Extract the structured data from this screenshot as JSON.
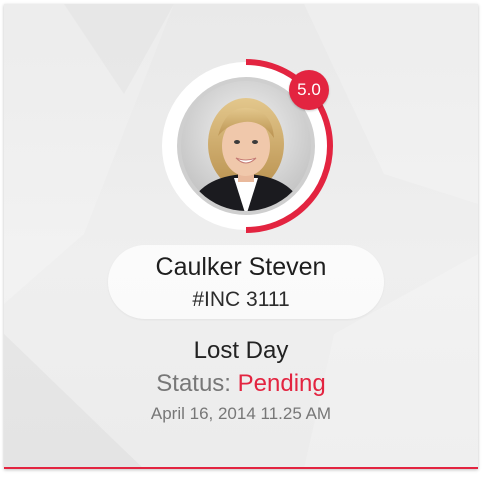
{
  "colors": {
    "accent": "#e32440",
    "name_text": "#1e1e1e",
    "muted_text": "#777777",
    "card_background": "#ececec"
  },
  "profile": {
    "name": "Caulker Steven",
    "incident_id": "#INC 3111",
    "rating": "5.0",
    "rating_fraction": 0.5,
    "avatar": "portrait-photo"
  },
  "incident": {
    "type": "Lost Day",
    "status_label": "Status:",
    "status_value": "Pending",
    "datetime": "April 16, 2014 11.25 AM"
  }
}
